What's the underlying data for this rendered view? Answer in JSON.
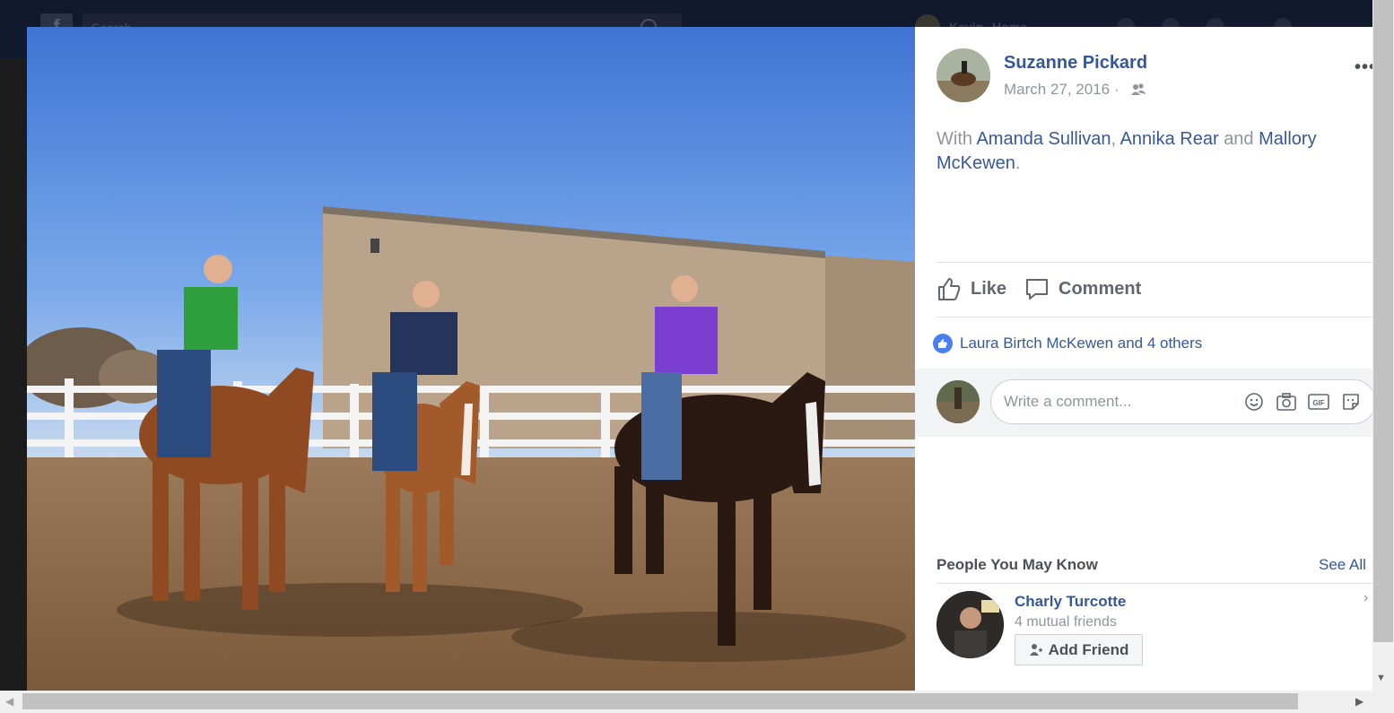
{
  "background": {
    "search_placeholder": "Search",
    "user_name": "Kevin",
    "home_label": "Home"
  },
  "post": {
    "author": "Suzanne Pickard",
    "date": "March 27, 2016",
    "date_separator": "·",
    "audience_icon": "friends-icon",
    "tagged": {
      "prefix": "With",
      "people": [
        "Amanda Sullivan",
        "Annika Rear",
        "Mallory McKewen"
      ],
      "sep1": ",",
      "sep2": "and",
      "end": "."
    }
  },
  "actions": {
    "like_label": "Like",
    "comment_label": "Comment"
  },
  "reactions": {
    "summary": "Laura Birtch McKewen and 4 others"
  },
  "comment": {
    "placeholder": "Write a comment...",
    "icons": [
      "emoji-icon",
      "camera-icon",
      "gif-icon",
      "sticker-icon"
    ]
  },
  "pymk": {
    "title": "People You May Know",
    "see_all": "See All",
    "person": {
      "name": "Charly Turcotte",
      "mutual": "4 mutual friends",
      "add_label": "Add Friend"
    }
  },
  "colors": {
    "link": "#365899",
    "muted": "#90949c",
    "like_blue": "#4a7ff0"
  }
}
